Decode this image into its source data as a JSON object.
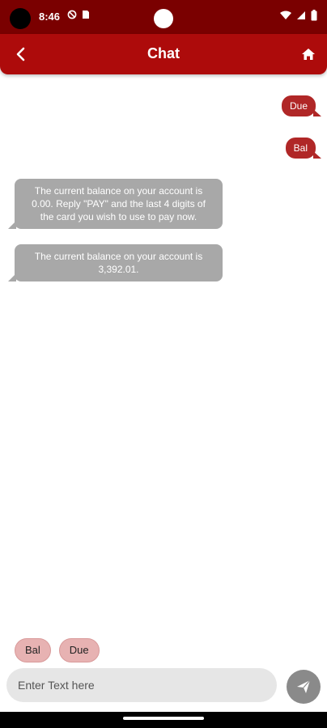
{
  "status_bar": {
    "time": "8:46",
    "left_icons": [
      "do-not-disturb-icon",
      "sim-card-icon"
    ],
    "right_icons": [
      "wifi-icon",
      "signal-icon",
      "battery-icon"
    ]
  },
  "app_bar": {
    "title": "Chat",
    "back_icon": "chevron-left-icon",
    "home_icon": "home-icon",
    "color": "#ad0b0b"
  },
  "messages": [
    {
      "sender": "user",
      "text": "Due"
    },
    {
      "sender": "user",
      "text": "Bal"
    },
    {
      "sender": "bot",
      "lines": [
        "The current balance on your account is",
        "0.00. Reply \"PAY\" and the last 4 digits of",
        "the card you wish to use to pay now."
      ]
    },
    {
      "sender": "bot",
      "lines": [
        "The current balance on your account is",
        "3,392.01."
      ]
    }
  ],
  "quick_replies": [
    "Bal",
    "Due"
  ],
  "input": {
    "placeholder": "Enter Text here",
    "value": ""
  },
  "send_icon": "send-icon",
  "colors": {
    "user_bubble": "#b02727",
    "bot_bubble": "#a8a8a8",
    "chip": "#e7b2b2"
  }
}
